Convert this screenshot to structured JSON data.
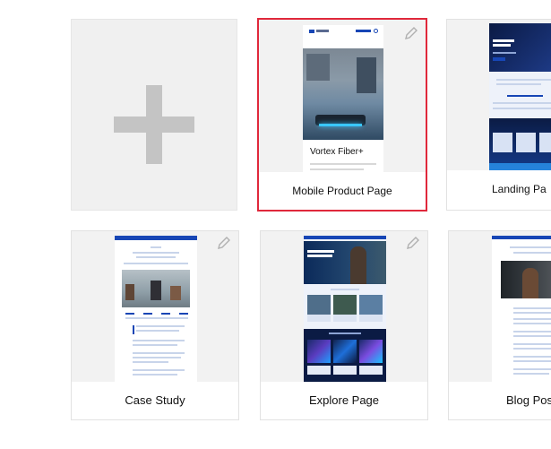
{
  "cards": [
    {
      "label": "Mobile Product Page",
      "selected": true
    },
    {
      "label": "Landing Pa"
    },
    {
      "label": "Case Study"
    },
    {
      "label": "Explore Page"
    },
    {
      "label": "Blog Pos"
    }
  ],
  "mobile_preview": {
    "product_title": "Vortex Fiber+"
  },
  "colors": {
    "selected_border": "#e0283b",
    "brand_blue": "#1746b5",
    "dark_navy": "#0b1b44"
  }
}
